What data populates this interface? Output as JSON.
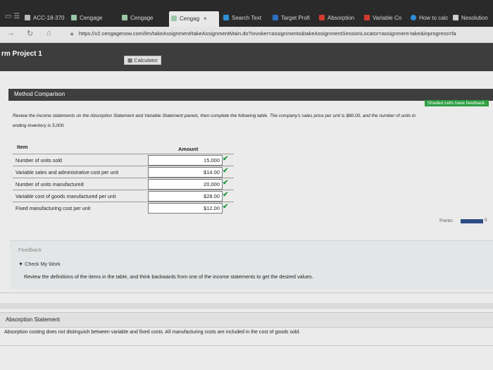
{
  "browser": {
    "tabs": [
      {
        "label": "ACC-18-370",
        "color": "#bbbbbb"
      },
      {
        "label": "Cengage",
        "color": "#9ac7a5"
      },
      {
        "label": "Cengage",
        "color": "#9ac7a5"
      },
      {
        "label": "Cengag",
        "color": "#9ac7a5",
        "active": true
      },
      {
        "label": "Search Text",
        "color": "#2e8fd8"
      },
      {
        "label": "Target Profi",
        "color": "#2a6fc0"
      },
      {
        "label": "Absorption",
        "color": "#d33a2f"
      },
      {
        "label": "Variable Co",
        "color": "#d33a2f"
      },
      {
        "label": "How to calc",
        "color": "#2e8fd8"
      },
      {
        "label": "Nesolution",
        "color": "#cfcfcf"
      }
    ],
    "url": "https://v2.cengagenow.com/ilrn/takeAssignment/takeAssignmentMain.do?invoker=assignments&takeAssignmentSessionLocator=assignment-take&inprogress=fa"
  },
  "app": {
    "project": "rm Project 1",
    "calculator": "Calculator"
  },
  "panel": {
    "title": "Method Comparison",
    "shaded_note": "Shaded cells have feedback.",
    "instructions_line1": "Review the income statements on the Absorption Statement and Variable Statement panels, then complete the following table. The company's sales price per unit is $80.00, and the number of units in",
    "instructions_line2": "ending inventory is 5,000."
  },
  "table": {
    "header_item": "Item",
    "header_amount": "Amount",
    "rows": [
      {
        "item": "Number of units sold",
        "amount": "15,000"
      },
      {
        "item": "Variable sales and administrative cost per unit",
        "amount": "$14.00"
      },
      {
        "item": "Number of units manufactured",
        "amount": "20,000"
      },
      {
        "item": "Variable cost of goods manufactured per unit",
        "amount": "$28.00"
      },
      {
        "item": "Fixed manufacturing cost per unit",
        "amount": "$12.00"
      }
    ],
    "check_mark": "✔"
  },
  "points": {
    "label": "Points:",
    "value": "5"
  },
  "feedback": {
    "title": "Feedback",
    "toggle": "Check My Work",
    "text": "Review the definitions of the items in the table, and think backwards from one of the income statements to get the desired values."
  },
  "absorption": {
    "title": "Absorption Statement",
    "text": "Absorption costing does not distinguish between variable and fixed costs. All manufacturing costs are included in the cost of goods sold."
  }
}
